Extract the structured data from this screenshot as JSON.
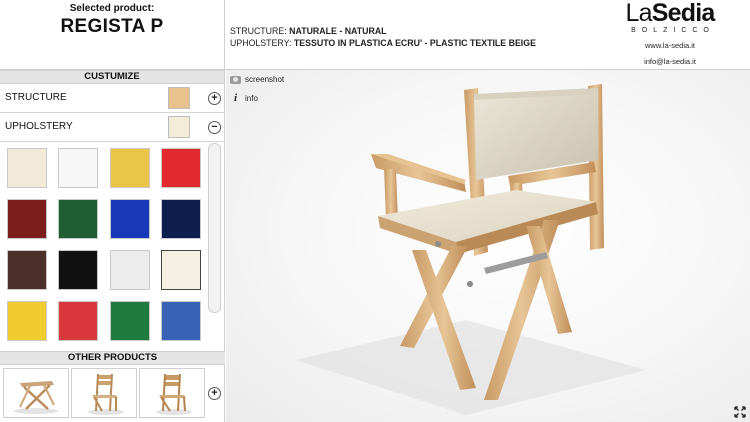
{
  "header": {
    "selected_caption": "Selected product:",
    "product_name": "REGISTA P",
    "structure_key": "STRUCTURE:",
    "structure_value": "NATURALE - NATURAL",
    "upholstery_key": "UPHOLSTERY:",
    "upholstery_value": "TESSUTO IN PLASTICA ECRU' - PLASTIC TEXTILE BEIGE",
    "logo_la": "La",
    "logo_sedia": "Sedia",
    "logo_sub": "BOLZICCO",
    "website": "www.la-sedia.it",
    "email": "info@la-sedia.it"
  },
  "customize": {
    "title": "CUSTUMIZE",
    "structure_label": "STRUCTURE",
    "structure_color": "#e8c18d",
    "structure_toggle": "+",
    "upholstery_label": "UPHOLSTERY",
    "upholstery_color": "#f3ecd9",
    "upholstery_toggle": "−"
  },
  "swatches": [
    "#f2ead8",
    "#f7f7f7",
    "#eac547",
    "#e22a2e",
    "#7c1d1e",
    "#1f5e32",
    "#1738b9",
    "#0f1f4d",
    "#4c2f29",
    "#111111",
    "#ececec",
    "#f4efe0",
    "#f0cc2e",
    "#d8373b",
    "#1f7a3e",
    "#3862b4"
  ],
  "other_products": {
    "title": "OTHER PRODUCTS",
    "add": "+",
    "items": [
      "stool-icon",
      "folding-chair-icon",
      "folding-chair-icon"
    ]
  },
  "viewer": {
    "screenshot_label": "screenshot",
    "info_label": "info",
    "info_glyph": "i"
  }
}
